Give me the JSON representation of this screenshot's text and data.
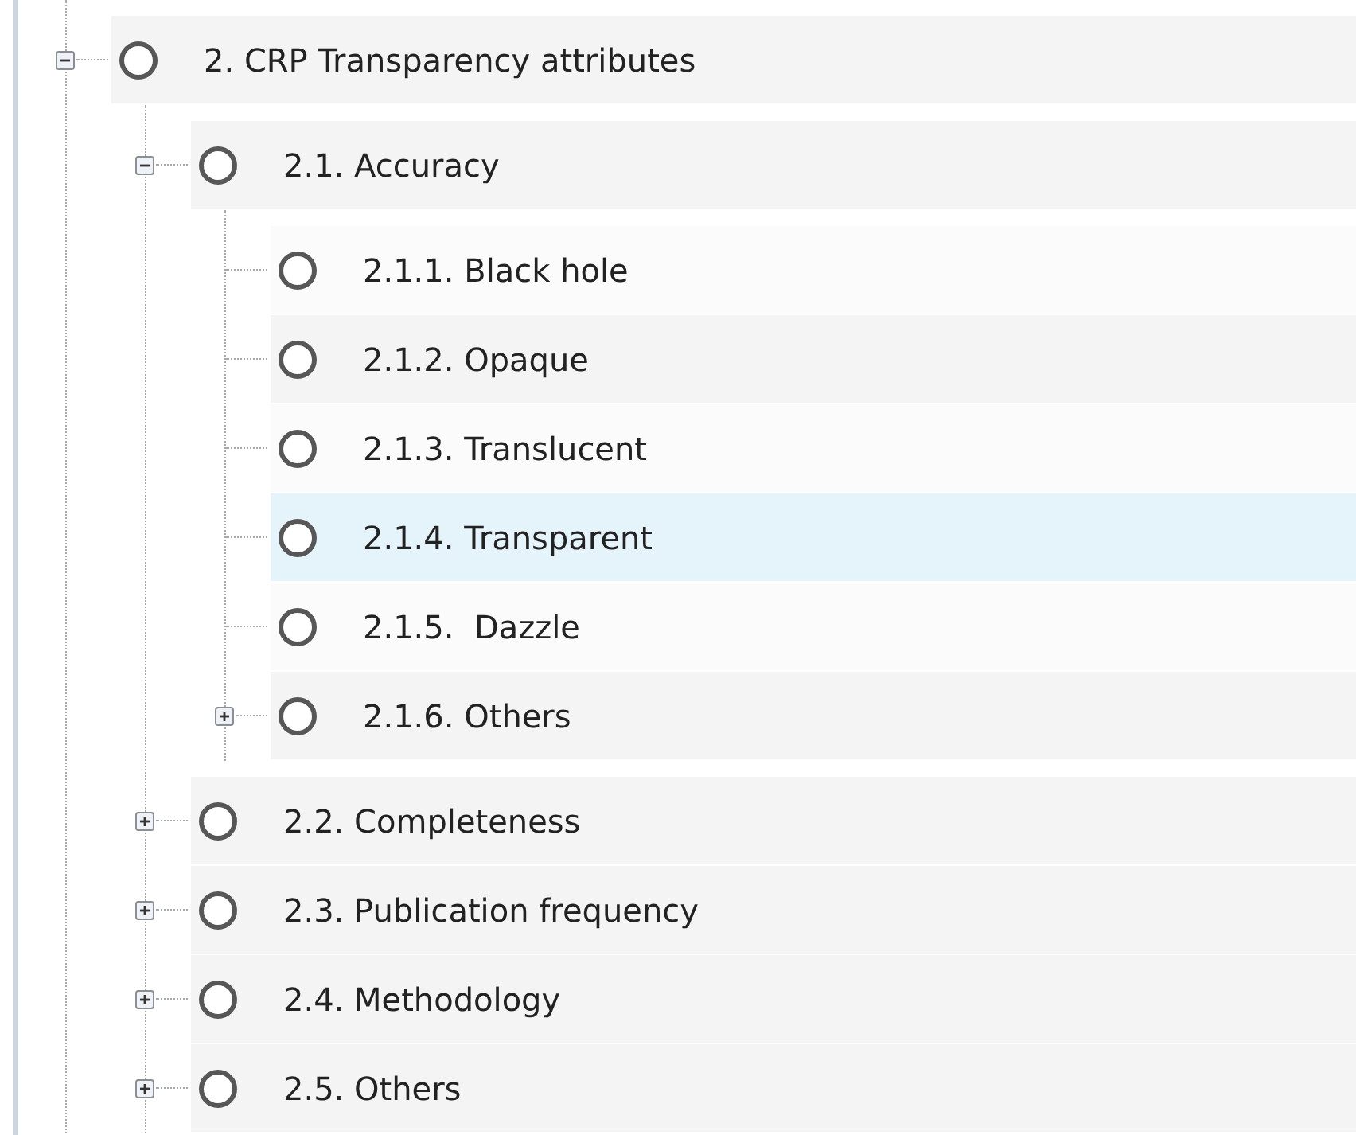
{
  "tree": [
    {
      "label": "2. CRP Transparency attributes",
      "expanded": true,
      "checked": false,
      "selected": false,
      "children": [
        {
          "label": "2.1. Accuracy",
          "expanded": true,
          "checked": false,
          "selected": false,
          "children": [
            {
              "label": "2.1.1. Black hole",
              "checked": false,
              "selected": false
            },
            {
              "label": "2.1.2. Opaque",
              "checked": false,
              "selected": false
            },
            {
              "label": "2.1.3. Translucent",
              "checked": false,
              "selected": false
            },
            {
              "label": "2.1.4. Transparent",
              "checked": false,
              "selected": true
            },
            {
              "label": "2.1.5.  Dazzle",
              "checked": false,
              "selected": false
            },
            {
              "label": "2.1.6. Others",
              "expanded": false,
              "checked": false,
              "selected": false
            }
          ]
        },
        {
          "label": "2.2. Completeness",
          "expanded": false,
          "checked": false,
          "selected": false
        },
        {
          "label": "2.3. Publication frequency",
          "expanded": false,
          "checked": false,
          "selected": false
        },
        {
          "label": "2.4. Methodology",
          "expanded": false,
          "checked": false,
          "selected": false
        },
        {
          "label": "2.5. Others",
          "expanded": false,
          "checked": false,
          "selected": false
        }
      ]
    }
  ]
}
